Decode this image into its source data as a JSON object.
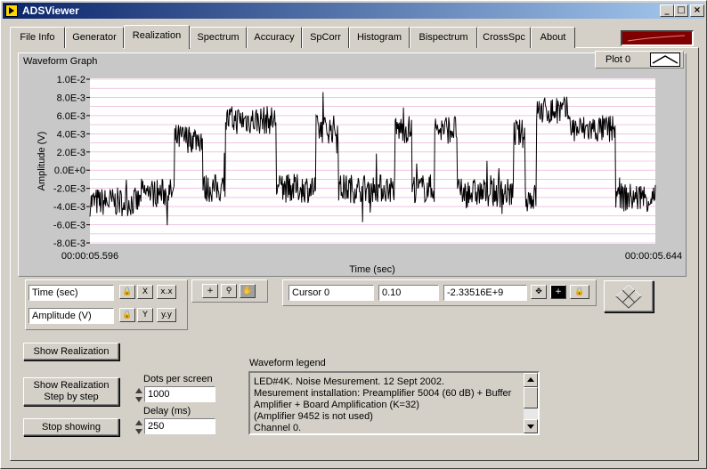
{
  "window": {
    "title": "ADSViewer",
    "minimize": "_",
    "maximize": "□",
    "close": "×"
  },
  "tabs": [
    {
      "label": "File Info"
    },
    {
      "label": "Generator"
    },
    {
      "label": "Realization"
    },
    {
      "label": "Spectrum"
    },
    {
      "label": "Accuracy"
    },
    {
      "label": "SpCorr"
    },
    {
      "label": "Histogram"
    },
    {
      "label": "Bispectrum"
    },
    {
      "label": "CrossSpc"
    },
    {
      "label": "About"
    }
  ],
  "active_tab": "Realization",
  "graph": {
    "title": "Waveform Graph",
    "plot_legend": "Plot 0",
    "colors": {
      "plot_bg": "#ffffff",
      "grid": "#e8a0d0",
      "trace": "#000000"
    }
  },
  "chart_data": {
    "type": "line",
    "xlabel": "Time (sec)",
    "ylabel": "Amplitude (V)",
    "x_tick_labels": [
      "00:00:05.596",
      "00:00:05.644"
    ],
    "ylim": [
      -0.008,
      0.01
    ],
    "y_tick_labels": [
      "1.0E-2",
      "8.0E-3",
      "6.0E-3",
      "4.0E-3",
      "2.0E-3",
      "0.0E+0",
      "-2.0E-3",
      "-4.0E-3",
      "-6.0E-3",
      "-8.0E-3"
    ],
    "grid": true,
    "trace_levels": [
      {
        "from": 0.0,
        "to": 0.09,
        "y": -0.0035
      },
      {
        "from": 0.09,
        "to": 0.15,
        "y": -0.0025
      },
      {
        "from": 0.15,
        "to": 0.2,
        "y": 0.0035
      },
      {
        "from": 0.2,
        "to": 0.24,
        "y": -0.002
      },
      {
        "from": 0.24,
        "to": 0.33,
        "y": 0.0055
      },
      {
        "from": 0.33,
        "to": 0.4,
        "y": -0.002
      },
      {
        "from": 0.4,
        "to": 0.44,
        "y": 0.0045
      },
      {
        "from": 0.44,
        "to": 0.54,
        "y": -0.002
      },
      {
        "from": 0.54,
        "to": 0.57,
        "y": 0.0045
      },
      {
        "from": 0.57,
        "to": 0.61,
        "y": -0.002
      },
      {
        "from": 0.61,
        "to": 0.65,
        "y": 0.0045
      },
      {
        "from": 0.65,
        "to": 0.75,
        "y": -0.0025
      },
      {
        "from": 0.75,
        "to": 0.77,
        "y": 0.004
      },
      {
        "from": 0.77,
        "to": 0.79,
        "y": -0.003
      },
      {
        "from": 0.79,
        "to": 0.85,
        "y": 0.0065
      },
      {
        "from": 0.85,
        "to": 0.93,
        "y": 0.0045
      },
      {
        "from": 0.93,
        "to": 1.0,
        "y": -0.003
      }
    ]
  },
  "axis_controls": {
    "x_name": "Time (sec)",
    "y_name": "Amplitude (V)"
  },
  "cursor": {
    "name": "Cursor 0",
    "x_value": "0.10",
    "y_value": "-2.33516E+9"
  },
  "buttons": {
    "show_realization": "Show Realization",
    "step_line1": "Show Realization",
    "step_line2": "Step by step",
    "stop": "Stop showing"
  },
  "dots_per_screen": {
    "label": "Dots per screen",
    "value": "1000"
  },
  "delay": {
    "label": "Delay (ms)",
    "value": "250"
  },
  "waveform_legend": {
    "label": "Waveform legend",
    "lines": [
      "LED#4K. Noise Mesurement. 12 Sept 2002.",
      "Mesurement installation: Preamplifier 5004 (60 dB) + Buffer",
      "Amplifier + Board Amplification (K=32)",
      "(Amplifier 9452 is not used)",
      "Channel 0."
    ]
  }
}
